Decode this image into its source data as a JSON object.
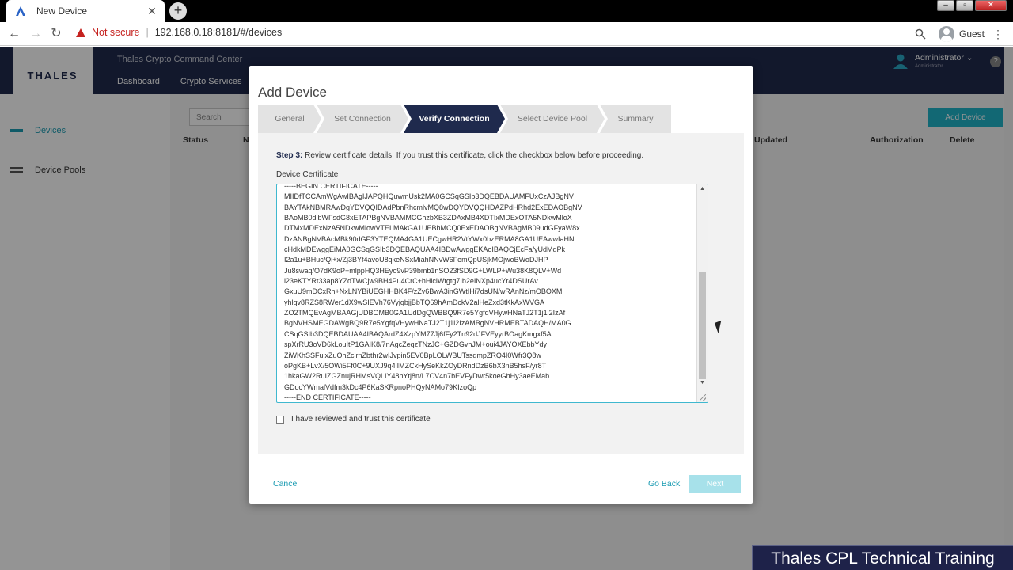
{
  "browser": {
    "tab_title": "New Device",
    "security_label": "Not secure",
    "url": "192.168.0.18:8181/#/devices",
    "profile_label": "Guest"
  },
  "app": {
    "title": "Thales Crypto Command Center",
    "logo": "THALES",
    "nav": [
      "Dashboard",
      "Crypto Services"
    ],
    "user_name": "Administrator",
    "user_role": "Administrator",
    "sidebar": [
      "Devices",
      "Device Pools"
    ],
    "search_placeholder": "Search",
    "add_device_label": "Add Device",
    "columns": [
      "Status",
      "N",
      "Updated",
      "Authorization",
      "Delete"
    ]
  },
  "modal": {
    "title": "Add Device",
    "steps": [
      "General",
      "Set Connection",
      "Verify Connection",
      "Select Device Pool",
      "Summary"
    ],
    "active_step": "Verify Connection",
    "step_prefix": "Step 3:",
    "step_instruction": " Review certificate details. If you trust this certificate, click the checkbox below before proceeding.",
    "cert_label": "Device Certificate",
    "cert_lines": [
      "-----BEGIN CERTIFICATE-----",
      "MIIDfTCCAmWgAwIBAgIJAPQHQuwmUsk2MA0GCSqGSIb3DQEBDAUAMFUxCzAJBgNV",
      "BAYTAkNBMRAwDgYDVQQIDAdPbnRhcmlvMQ8wDQYDVQQHDAZPdHRhd2ExEDAOBgNV",
      "BAoMB0dlbWFsdG8xETAPBgNVBAMMCGhzbXB3ZDAxMB4XDTIxMDExOTA5NDkwMloX",
      "DTMxMDExNzA5NDkwMlowVTELMAkGA1UEBhMCQ0ExEDAOBgNVBAgMB09udGFyaW8x",
      "DzANBgNVBAcMBk90dGF3YTEQMA4GA1UECgwHR2VtYWx0bzERMA8GA1UEAwwIaHNt",
      "cHdkMDEwggEiMA0GCSqGSIb3DQEBAQUAA4IBDwAwggEKAoIBAQCjEcFa/yUdMdPk",
      "I2a1u+BHuc/Qi+x/Zj3BYf4avoU8qkeNSxMiahNNvW6FemQpUSjkMOjwoBWoDJHP",
      "Ju8swaq/O7dK9oP+mlppHQ3HEyo9vP39bmb1nSO23fSD9G+LWLP+Wu38K8QLV+Wd",
      "l23eKTYRt33ap8YZdTWCjw9BH4Pu4CrC+hHlciWtgtg7Ib2eINXp4ucYr4DSUrAv",
      "GxuU9mDCxRh+NxLNYBiUEGHHBK4F/zZv6BwA3inGWtIHi7dsUN/wRAnNz/mOBOXM",
      "yhlqv8RZS8RWer1dX9wSIEVh76VyjqbjjBbTQ69hAmDckV2alHeZxd3tKkAxWVGA",
      "ZO2TMQEvAgMBAAGjUDBOMB0GA1UdDgQWBBQ9R7e5YgfqVHywHNaTJ2T1j1i2IzAf",
      "BgNVHSMEGDAWgBQ9R7e5YgfqVHywHNaTJ2T1j1i2IzAMBgNVHRMEBTADAQH/MA0G",
      "CSqGSIb3DQEBDAUAA4IBAQArdZ4XzpYM77Jj6fFy2Tn92dJFVEyyrBOagKmgxf5A",
      "spXrRU3oVD6kLouItP1GAIK8/7nAgcZeqzTNzJC+GZDGvhJM+oui4JAYOXEbbYdy",
      "ZiWKhSSFulxZuOhZcjrnZbthr2wIJvpin5EV0BpLOLWBUTssqmpZRQ4I0Wfr3Q8w",
      "oPgKB+LvX/5OWi5Ff0C+9UXJ9q4lIMZCkHySeKkZOyDRndDzB6bX3nB5hsF/yr8T",
      "1hkaGW2RuIZGZnujRHMsVQLIY48hYtj8n/L7CV4n7bEVFyDwr5koeGhHy3aeEMab",
      "GDocYWmalVdfm3kDc4P6KaSKRpnoPHQyNAMo79KIzoQp",
      "-----END CERTIFICATE-----"
    ],
    "trust_label": "I have reviewed and trust this certificate",
    "trust_checked": false,
    "cancel_label": "Cancel",
    "back_label": "Go Back",
    "next_label": "Next"
  },
  "overlay_banner": "Thales CPL Technical Training",
  "colors": {
    "accent": "#1a9bb2",
    "header": "#1f2a4d",
    "next_disabled": "#a7e1ea"
  }
}
